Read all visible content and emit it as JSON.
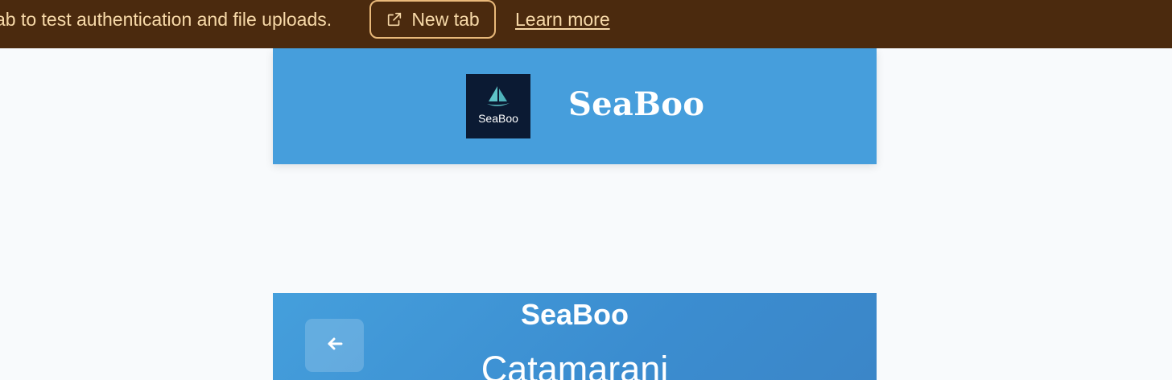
{
  "banner": {
    "message": "ab to test authentication and file uploads.",
    "new_tab_label": "New tab",
    "new_tab_icon": "external-link-icon",
    "learn_more_label": "Learn more",
    "background": "#4b2a0e",
    "text_color": "#f7d9a8"
  },
  "header": {
    "logo_text": "SeaBoo",
    "logo_icon": "sailboat-icon",
    "title": "SeaBoo",
    "background": "#469edc"
  },
  "section": {
    "brand": "SeaBoo",
    "title": "Catamarani",
    "back_icon": "arrow-left-icon"
  }
}
